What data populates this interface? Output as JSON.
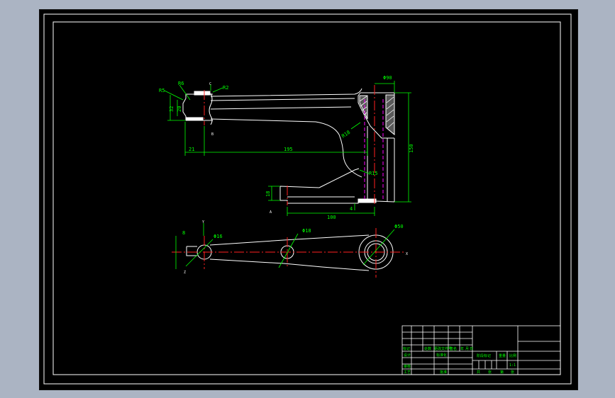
{
  "colors": {
    "background": "#abb4c3",
    "sheet": "#000000",
    "outline": "#ffffff",
    "dimension": "#00ff00",
    "centerline": "#ff2020",
    "hidden": "#ff00ff"
  },
  "views": {
    "front": {
      "dims": {
        "r5": "R5",
        "r6": "R6",
        "r2": "R2",
        "d32": "32",
        "d20": "20",
        "d21": "21",
        "d195": "195",
        "phi90": "Φ90",
        "r15": "R15",
        "r18": "R18",
        "d150": "150",
        "d18": "18",
        "d4": "4",
        "d100": "100"
      },
      "marks": {
        "c": "C",
        "b": "B",
        "a": "A"
      }
    },
    "top": {
      "dims": {
        "d8": "8",
        "phi16": "Φ16",
        "phi18": "Φ18",
        "phi50": "Φ50"
      },
      "marks": {
        "y": "Y",
        "z": "Z",
        "x": "X"
      }
    }
  },
  "title_block": {
    "cells": {
      "c1": "标记",
      "c2": "处数",
      "c3": "更改文件号",
      "c4": "签名",
      "c5": "年",
      "c6": "月",
      "c7": "日",
      "c8": "设计",
      "c9": "标准化",
      "c10": "审核",
      "c11": "工艺",
      "c12": "批准",
      "c13": "阶段标记",
      "c14": "重量",
      "c15": "比例",
      "c16": "1:1",
      "c17": "共",
      "c18": "张",
      "c19": "第",
      "c20": "张"
    }
  }
}
